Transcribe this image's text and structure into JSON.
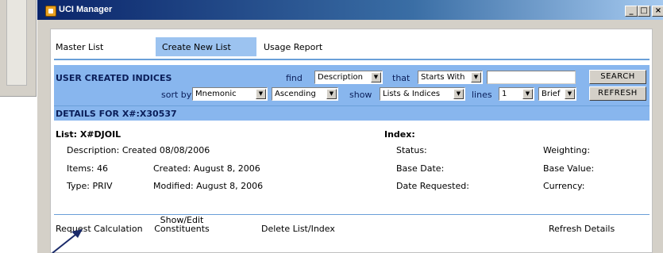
{
  "window": {
    "title": "UCI Manager",
    "min_label": "_",
    "max_label": "□",
    "close_label": "×"
  },
  "nav": {
    "master": "Master List",
    "create": "Create New List",
    "usage": "Usage Report"
  },
  "search_panel": {
    "title": "USER CREATED INDICES",
    "find_label": "find",
    "find_value": "Description",
    "that_label": "that",
    "that_value": "Starts With",
    "search_text": "",
    "search_button": "SEARCH",
    "sortby_label": "sort by",
    "sortby_value": "Mnemonic",
    "order_value": "Ascending",
    "show_label": "show",
    "show_value": "Lists & Indices",
    "lines_label": "lines",
    "lines_value": "1",
    "detail_value": "Brief",
    "refresh_button": "REFRESH"
  },
  "details": {
    "header": "DETAILS FOR X#:X30537",
    "list_label": "List: X#DJOIL",
    "description": "Description: Created 08/08/2006",
    "items": "Items: 46",
    "created": "Created: August 8, 2006",
    "type": "Type: PRIV",
    "modified": "Modified: August 8, 2006",
    "index_label": "Index:",
    "status": "Status:",
    "base_date": "Base Date:",
    "date_requested": "Date Requested:",
    "weighting": "Weighting:",
    "base_value": "Base Value:",
    "currency": "Currency:"
  },
  "actions": {
    "request_calc": "Request Calculation",
    "show_edit_1": "Show/Edit",
    "show_edit_2": "Constituents",
    "delete": "Delete List/Index",
    "refresh": "Refresh Details"
  },
  "colors": {
    "titlebar": "#0a246a",
    "panel": "#88b6ee",
    "nav_active": "#9cc3f0",
    "arrow": "#1a2a6a"
  },
  "icons": {
    "app": "app-icon",
    "annotation": "annotation-arrow"
  }
}
